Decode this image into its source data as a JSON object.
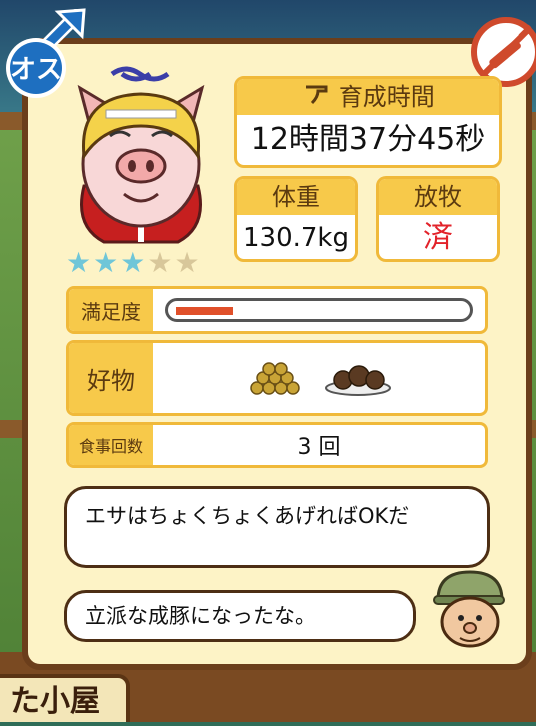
{
  "gender_badge": "オス",
  "grow_time": {
    "label": "育成時間",
    "value": "12時間37分45秒"
  },
  "weight": {
    "label": "体重",
    "value": "130.7kg"
  },
  "grazing": {
    "label": "放牧",
    "value": "済"
  },
  "rating": {
    "stars_filled": 3,
    "stars_total": 5,
    "star_filled_glyph": "★",
    "star_empty_glyph": "★"
  },
  "satisfaction": {
    "label": "満足度",
    "level": 0.2
  },
  "favorite_food": {
    "label": "好物",
    "items": [
      "soybeans-icon",
      "chocolate-balls-icon"
    ]
  },
  "meal_count": {
    "label": "食事回数",
    "value": "3 回"
  },
  "dialog": {
    "line1": "エサはちょくちょくあげればOKだ",
    "line2": "立派な成豚になったな。"
  },
  "hut_sign": "た小屋",
  "colors": {
    "accent": "#f7c94a",
    "border": "#6b3e1b",
    "grazing_value": "#e2222a",
    "bar_fill": "#e0502a",
    "star_filled": "#6fc6d8",
    "star_empty": "#d8c79a"
  }
}
